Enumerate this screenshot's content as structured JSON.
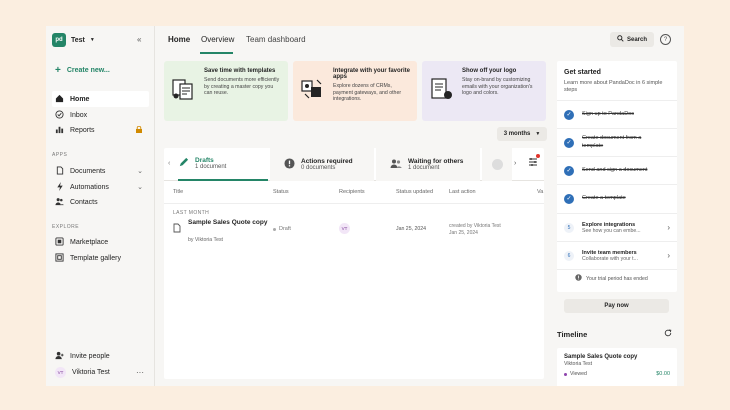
{
  "workspace": {
    "logo": "pd",
    "name": "Test",
    "menu_icon": "caret-down-icon",
    "collapse_icon": "double-chevron-left-icon"
  },
  "sidebar": {
    "create_label": "Create new...",
    "items": [
      {
        "label": "Home",
        "icon": "home-icon"
      },
      {
        "label": "Inbox",
        "icon": "inbox-icon"
      },
      {
        "label": "Reports",
        "icon": "reports-icon"
      }
    ],
    "apps_heading": "APPS",
    "apps": [
      {
        "label": "Documents",
        "icon": "document-icon"
      },
      {
        "label": "Automations",
        "icon": "lightning-icon"
      },
      {
        "label": "Contacts",
        "icon": "contacts-icon"
      }
    ],
    "explore_heading": "EXPLORE",
    "explore": [
      {
        "label": "Marketplace",
        "icon": "marketplace-icon"
      },
      {
        "label": "Template gallery",
        "icon": "gallery-icon"
      }
    ],
    "invite_label": "Invite people",
    "user": {
      "initials": "VT",
      "name": "Viktoria Test"
    }
  },
  "header": {
    "title": "Home",
    "tabs": [
      "Overview",
      "Team dashboard"
    ],
    "search_label": "Search",
    "help_label": "?"
  },
  "promo_cards": [
    {
      "title": "Save time with templates",
      "text": "Send documents more efficiently by creating a master copy you can reuse.",
      "bg": "#e8f3e4"
    },
    {
      "title": "Integrate with your favorite apps",
      "text": "Explore dozens of CRMs, payment gateways, and other integrations.",
      "bg": "#fbe9dc"
    },
    {
      "title": "Show off your logo",
      "text": "Stay on-brand by customizing emails with your organization's logo and colors.",
      "bg": "#ece8f4"
    }
  ],
  "period": "3 months",
  "status_tabs": [
    {
      "title": "Drafts",
      "sub": "1 document"
    },
    {
      "title": "Actions required",
      "sub": "0 documents"
    },
    {
      "title": "Waiting for others",
      "sub": "1 document"
    }
  ],
  "table": {
    "columns": [
      "Title",
      "Status",
      "Recipients",
      "Status updated",
      "Last action",
      "Va"
    ],
    "group": "LAST MONTH",
    "rows": [
      {
        "title": "Sample Sales Quote copy",
        "by": "by Viktoria Test",
        "status": "Draft",
        "recipient": "VT",
        "updated": "Jan 25, 2024",
        "last_action": "created by Viktoria Test",
        "last_action_date": "Jan 25, 2024"
      }
    ]
  },
  "get_started": {
    "title": "Get started",
    "subtitle": "Learn more about PandaDoc in 6 simple steps",
    "done": [
      "Sign up to PandaDoc",
      "Create document from a template",
      "Send and sign a document",
      "Create a template"
    ],
    "todo": [
      {
        "num": "5",
        "title": "Explore integrations",
        "sub": "See how you can embe..."
      },
      {
        "num": "6",
        "title": "Invite team members",
        "sub": "Collaborate with your t..."
      }
    ],
    "trial_text": "Your trial period has ended",
    "pay_label": "Pay now"
  },
  "timeline": {
    "title": "Timeline",
    "item_title": "Sample Sales Quote copy",
    "item_user": "Viktoria Test",
    "item_status": "Viewed",
    "item_amount": "$0.00"
  }
}
